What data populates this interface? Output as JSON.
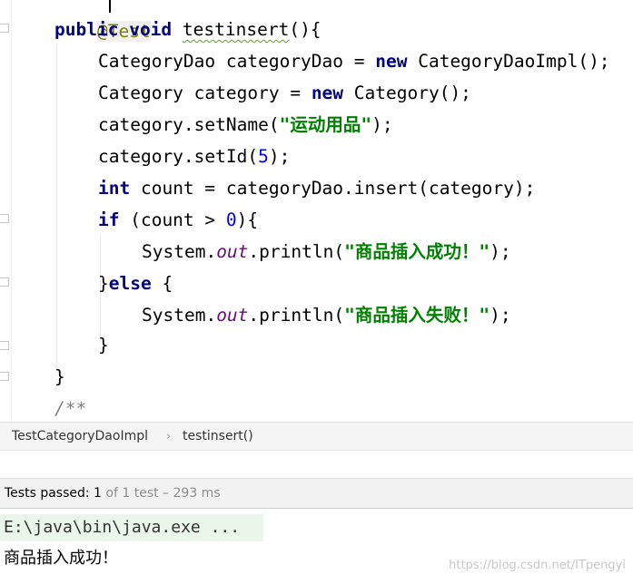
{
  "editor": {
    "annotation": "@Test",
    "lines": {
      "method_kw": "public",
      "method_void": "void",
      "method_name": "testinsert",
      "method_rest": "(){",
      "l2_type": "CategoryDao categoryDao = ",
      "l2_new": "new",
      "l2_rest": " CategoryDaoImpl();",
      "l3_type": "Category category = ",
      "l3_new": "new",
      "l3_rest": " Category();",
      "l4_pre": "category.setName(",
      "l4_str": "\"运动用品\"",
      "l4_post": ");",
      "l5_pre": "category.setId(",
      "l5_num": "5",
      "l5_post": ");",
      "l6_kw": "int",
      "l6_rest": " count = categoryDao.insert(category);",
      "l7_kw": "if",
      "l7_pre": " (count > ",
      "l7_num": "0",
      "l7_post": "){",
      "l8_pre": "System.",
      "l8_fld": "out",
      "l8_mid": ".println(",
      "l8_str": "\"商品插入成功！\"",
      "l8_post": ");",
      "l9_pre": "}",
      "l9_kw": "else",
      "l9_post": " {",
      "l10_pre": "System.",
      "l10_fld": "out",
      "l10_mid": ".println(",
      "l10_str": "\"商品插入失败！\"",
      "l10_post": ");",
      "l11": "}",
      "l12": "}",
      "l13": "/**"
    }
  },
  "breadcrumb": {
    "class_name": "TestCategoryDaoImpl",
    "separator": "›",
    "method_name": "testinsert()"
  },
  "tests": {
    "label": "Tests passed: ",
    "passed": "1",
    "detail": " of 1 test – 293 ms"
  },
  "console": {
    "command": "E:\\java\\bin\\java.exe ...",
    "output": "商品插入成功！"
  },
  "watermark": "https://blog.csdn.net/ITpengyi",
  "colors": {
    "keyword": "#000080",
    "string": "#008000",
    "number": "#0000ff",
    "field": "#660e7a",
    "comment": "#808080",
    "console_highlight": "#eaf6ea"
  }
}
